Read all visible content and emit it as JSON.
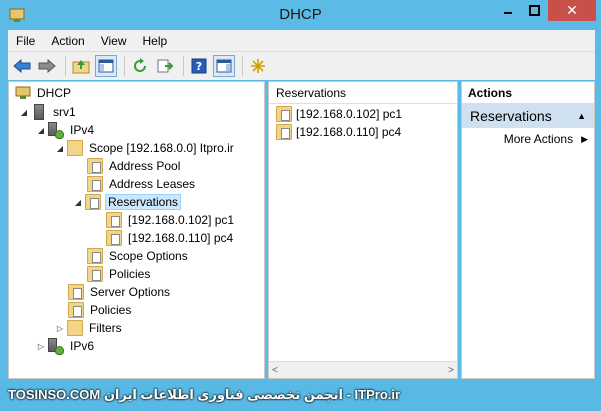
{
  "window": {
    "title": "DHCP"
  },
  "menu": [
    "File",
    "Action",
    "View",
    "Help"
  ],
  "toolbar": {
    "icons": [
      "back-arrow-icon",
      "forward-arrow-icon",
      "up-folder-icon",
      "show-hide-console-tree-icon",
      "refresh-icon",
      "export-list-icon",
      "help-icon",
      "show-hide-action-pane-icon",
      "star-icon"
    ]
  },
  "tree": {
    "root": "DHCP",
    "server": "srv1",
    "ipv4": "IPv4",
    "scope": "Scope [192.168.0.0] Itpro.ir",
    "address_pool": "Address Pool",
    "address_leases": "Address Leases",
    "reservations": "Reservations",
    "reservation_1": "[192.168.0.102] pc1",
    "reservation_2": "[192.168.0.110] pc4",
    "scope_options": "Scope Options",
    "policies_scope": "Policies",
    "server_options": "Server Options",
    "policies": "Policies",
    "filters": "Filters",
    "ipv6": "IPv6"
  },
  "reservations_pane": {
    "header": "Reservations",
    "items": [
      "[192.168.0.102] pc1",
      "[192.168.0.110] pc4"
    ]
  },
  "actions_pane": {
    "header": "Actions",
    "group": "Reservations",
    "items": [
      "More Actions"
    ]
  },
  "watermark": "TOSINSO.COM انجمن تخصصی فناوری اطلاعات ایران - ITPro.ir"
}
